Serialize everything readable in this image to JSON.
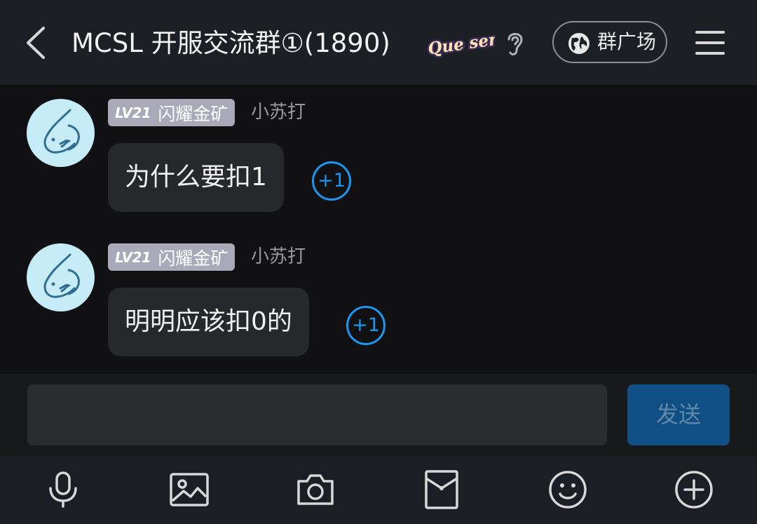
{
  "header": {
    "title": "MCSL 开服交流群①(1890)",
    "badge_text": "Que sera",
    "square_label": "群广场"
  },
  "messages": [
    {
      "level": "LV21",
      "rank": "闪耀金矿",
      "nickname": "小苏打",
      "text": "为什么要扣1",
      "reaction": "+1"
    },
    {
      "level": "LV21",
      "rank": "闪耀金矿",
      "nickname": "小苏打",
      "text": "明明应该扣0的",
      "reaction": "+1"
    }
  ],
  "composer": {
    "input_value": "",
    "send_label": "发送"
  },
  "toolbar": {
    "icons": [
      "microphone-icon",
      "image-icon",
      "camera-icon",
      "red-packet-icon",
      "emoji-icon",
      "plus-icon"
    ]
  },
  "colors": {
    "header_bg": "#1c1f24",
    "chat_bg": "#111113",
    "bubble_bg": "#27282c",
    "accent_blue": "#1a97ee",
    "send_bg": "#0f4f86",
    "level_tag_bg": "#a9a9ba",
    "avatar_bg": "#c6ecf7"
  }
}
